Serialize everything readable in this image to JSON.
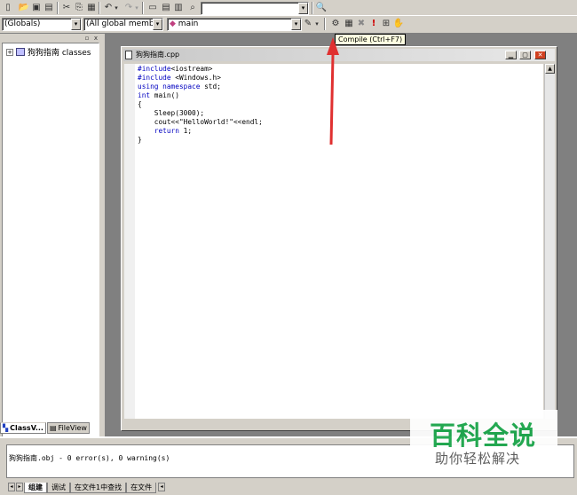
{
  "toolbar1": {
    "find_combo_value": "",
    "dropdown_glyph": "▾",
    "icons": {
      "new": "▯",
      "open": "📂",
      "save": "▣",
      "save_all": "▤",
      "cut": "✂",
      "copy": "⎘",
      "paste": "▦",
      "undo": "↶",
      "redo": "↷",
      "workspace": "▭",
      "output": "▤",
      "window_list": "▥",
      "find_in_files": "⌕",
      "find": "🔍"
    }
  },
  "toolbar2": {
    "class_combo": "(Globals)",
    "members_combo": "(All global members",
    "function_combo": "main",
    "function_marker": "◆",
    "dropdown_glyph": "▾",
    "icons": {
      "wizard": "✎",
      "compile": "⚙",
      "build": "▦",
      "stop_build": "✖",
      "execute": "!",
      "breakpoint": "⊞",
      "go": "✋"
    },
    "tooltip": "Compile (Ctrl+F7)"
  },
  "workspace": {
    "pane_buttons": {
      "restore": "▫",
      "close": "x"
    },
    "tree_root_expander": "+",
    "tree_root": "狗狗指南 classes",
    "tabs": [
      {
        "label": "ClassV...",
        "icon": "▚",
        "active": true
      },
      {
        "label": "FileView",
        "icon": "▤",
        "active": false
      }
    ]
  },
  "editor": {
    "title": "狗狗指南.cpp",
    "window_buttons": {
      "minimize": "▁",
      "maximize": "▢",
      "close": "✕"
    },
    "scroll_up": "▲",
    "code": [
      {
        "kw": "#include",
        "rest": "<iostream>"
      },
      {
        "kw": "#include",
        "rest": " <Windows.h>"
      },
      {
        "kw": "using namespace",
        "rest": " std;"
      },
      {
        "kw": "int",
        "rest": " main()"
      },
      {
        "kw": "",
        "rest": "{"
      },
      {
        "kw": "",
        "rest": "    Sleep(3000);"
      },
      {
        "kw": "",
        "rest": "    cout<<\"HelloWorld!\"<<endl;"
      },
      {
        "kw": "    return",
        "rest": " 1;"
      },
      {
        "kw": "",
        "rest": "}"
      }
    ]
  },
  "output": {
    "text": "狗狗指南.obj - 0 error(s), 0 warning(s)",
    "nav": [
      "◂",
      "▸"
    ],
    "tabs": [
      {
        "label": "组建",
        "active": true
      },
      {
        "label": "调试",
        "active": false
      },
      {
        "label": "在文件1中查找",
        "active": false
      },
      {
        "label": "在文件",
        "active": false
      }
    ],
    "tab_scroll": "◂"
  },
  "watermark": {
    "title": "百科全说",
    "subtitle": "助你轻松解决"
  },
  "colors": {
    "keyword": "#0000c0",
    "arrow": "#e03030",
    "watermark_green": "#1aa64a"
  }
}
